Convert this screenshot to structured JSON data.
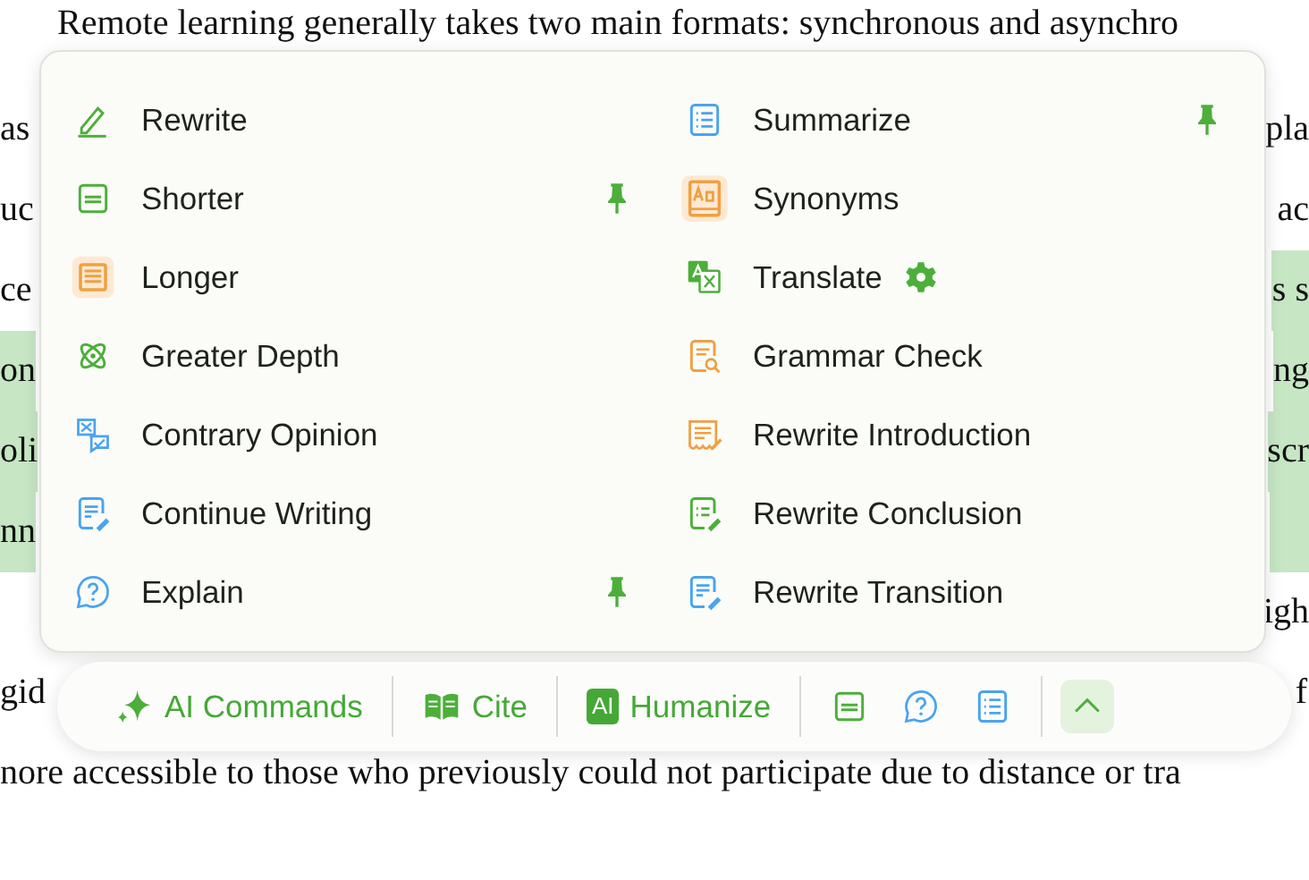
{
  "document": {
    "lines": [
      {
        "left": "Remote learning generally takes two main formats: synchronous and asynchro"
      },
      {
        "left": "as",
        "right": "pla",
        "left_highlighted": false,
        "right_highlighted": false
      },
      {
        "left": "uc",
        "right": "ac",
        "left_highlighted": false,
        "right_highlighted": false
      },
      {
        "left": "ce",
        "right": "s s",
        "left_highlighted": false,
        "right_highlighted": true
      },
      {
        "left": "on",
        "right": "ng",
        "left_highlighted": true,
        "right_highlighted": true
      },
      {
        "left": "oli",
        "right": "scr",
        "left_highlighted": true,
        "right_highlighted": true
      },
      {
        "left": "nn",
        "left_highlighted": true,
        "right_highlighted": true
      },
      {
        "right": "igh",
        "left_highlighted": false,
        "right_highlighted": false
      },
      {
        "left": "gid",
        "right": "f",
        "left_highlighted": false,
        "right_highlighted": false
      },
      {
        "left": "nore accessible to those who previously could not participate due to distance or tra"
      }
    ]
  },
  "menu": {
    "columns": [
      [
        {
          "label": "Rewrite",
          "kind": "pencil",
          "pinned": false
        },
        {
          "label": "Shorter",
          "kind": "shorter",
          "pinned": true
        },
        {
          "label": "Longer",
          "kind": "longer",
          "pinned": false
        },
        {
          "label": "Greater Depth",
          "kind": "atom",
          "pinned": false
        },
        {
          "label": "Contrary Opinion",
          "kind": "contrary",
          "pinned": false
        },
        {
          "label": "Continue Writing",
          "kind": "continue",
          "pinned": false
        },
        {
          "label": "Explain",
          "kind": "explain",
          "pinned": true
        }
      ],
      [
        {
          "label": "Summarize",
          "kind": "summarize",
          "pinned": true
        },
        {
          "label": "Synonyms",
          "kind": "synonyms",
          "pinned": false
        },
        {
          "label": "Translate",
          "kind": "translate",
          "pinned": false,
          "settings": true
        },
        {
          "label": "Grammar Check",
          "kind": "grammar",
          "pinned": false
        },
        {
          "label": "Rewrite Introduction",
          "kind": "intro",
          "pinned": false
        },
        {
          "label": "Rewrite Conclusion",
          "kind": "conclusion",
          "pinned": false
        },
        {
          "label": "Rewrite Transition",
          "kind": "transition",
          "pinned": false
        }
      ]
    ]
  },
  "toolbar": {
    "groups": [
      [
        {
          "kind": "sparkle",
          "label": "AI Commands"
        }
      ],
      [
        {
          "kind": "cite",
          "label": "Cite"
        }
      ],
      [
        {
          "kind": "humanize",
          "label": "Humanize",
          "badge": "AI"
        }
      ],
      [
        {
          "kind": "shorter"
        },
        {
          "kind": "explain"
        },
        {
          "kind": "summarize"
        }
      ],
      [
        {
          "kind": "collapse"
        }
      ]
    ]
  }
}
